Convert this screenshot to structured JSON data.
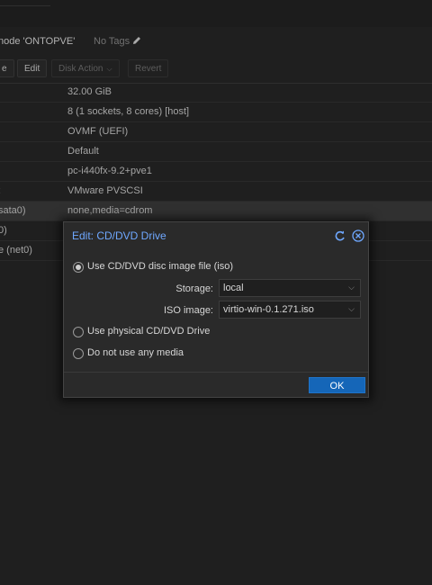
{
  "header": {
    "title": "node 'ONTOPVE'",
    "tags": "No Tags"
  },
  "toolbar": {
    "b0": "e",
    "edit": "Edit",
    "disk_action": "Disk Action",
    "revert": "Revert"
  },
  "rows": [
    {
      "key": "",
      "value": "32.00 GiB"
    },
    {
      "key": "",
      "value": "8 (1 sockets, 8 cores) [host]"
    },
    {
      "key": "",
      "value": "OVMF (UEFI)"
    },
    {
      "key": "",
      "value": "Default"
    },
    {
      "key": "",
      "value": "pc-i440fx-9.2+pve1"
    },
    {
      "key": ":",
      "value": "VMware PVSCSI"
    },
    {
      "key": "sata0)",
      "value": "none,media=cdrom"
    },
    {
      "key": "0)",
      "value": ""
    },
    {
      "key": "e (net0)",
      "value": ""
    }
  ],
  "dialog": {
    "title": "Edit: CD/DVD Drive",
    "option_iso": "Use CD/DVD disc image file (iso)",
    "storage_label": "Storage:",
    "storage_value": "local",
    "iso_label": "ISO image:",
    "iso_value": "virtio-win-0.1.271.iso",
    "option_physical": "Use physical CD/DVD Drive",
    "option_none": "Do not use any media",
    "ok": "OK"
  },
  "colors": {
    "accent": "#1566b8",
    "title_blue": "#6fa8ff",
    "background": "#262626"
  },
  "icons": [
    "pencil-icon",
    "reset-icon",
    "close-icon",
    "chevron-down-icon"
  ]
}
